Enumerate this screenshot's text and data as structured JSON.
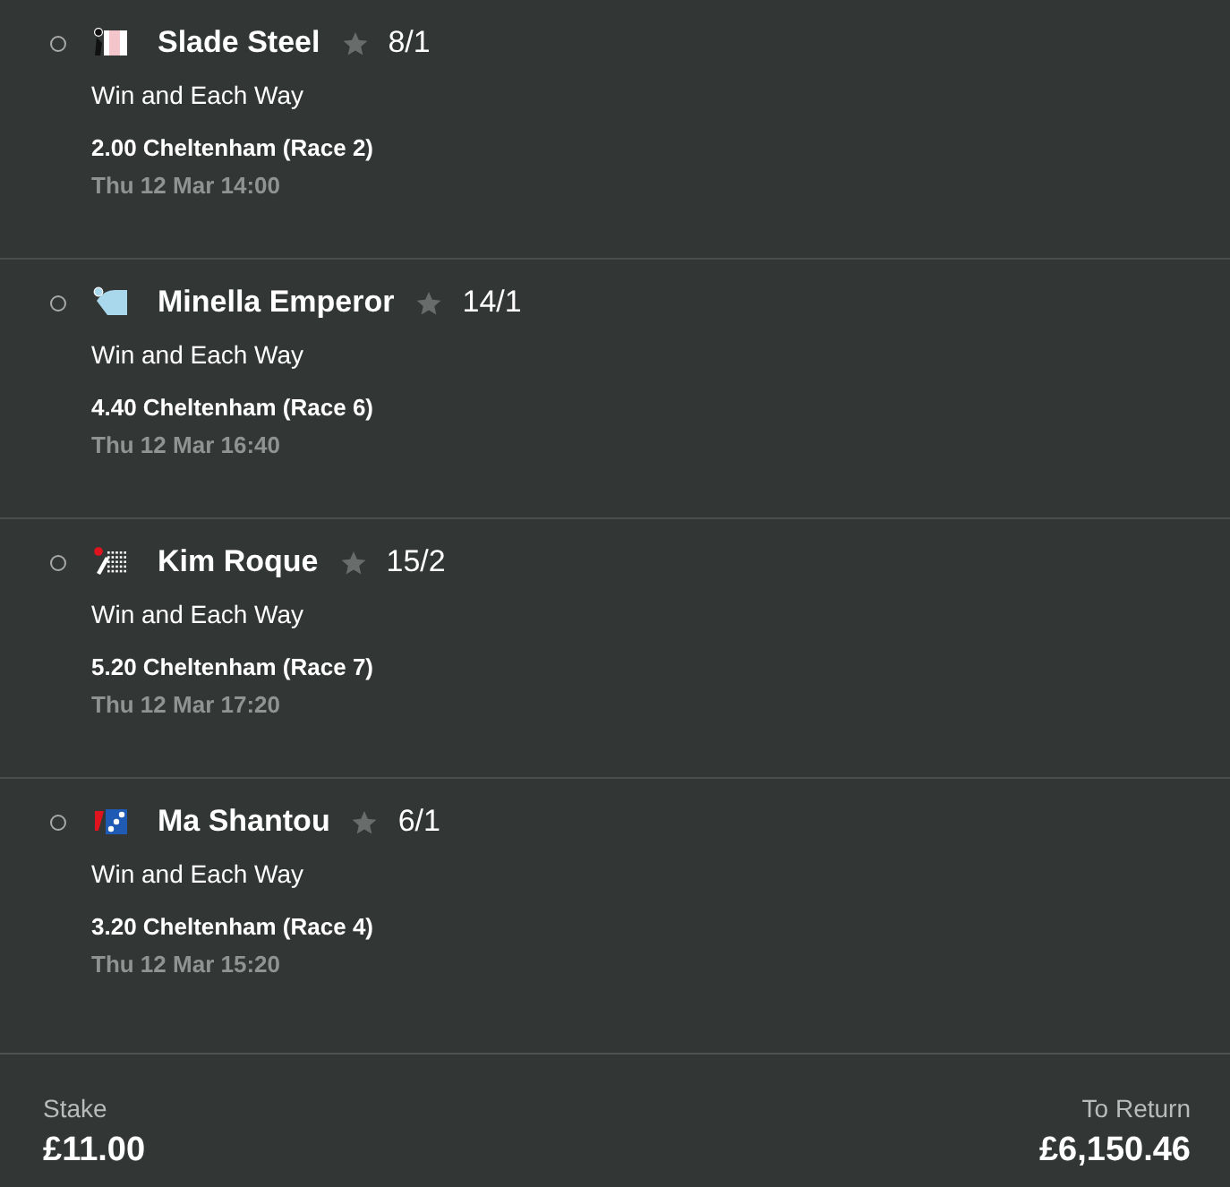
{
  "selections": [
    {
      "selected": false,
      "name": "Slade Steel",
      "odds": "8/1",
      "market": "Win and Each Way",
      "race": "2.00 Cheltenham (Race 2)",
      "time": "Thu 12 Mar 14:00"
    },
    {
      "selected": false,
      "name": "Minella Emperor",
      "odds": "14/1",
      "market": "Win and Each Way",
      "race": "4.40 Cheltenham (Race 6)",
      "time": "Thu 12 Mar 16:40"
    },
    {
      "selected": false,
      "name": "Kim Roque",
      "odds": "15/2",
      "market": "Win and Each Way",
      "race": "5.20 Cheltenham (Race 7)",
      "time": "Thu 12 Mar 17:20"
    },
    {
      "selected": false,
      "name": "Ma Shantou",
      "odds": "6/1",
      "market": "Win and Each Way",
      "race": "3.20 Cheltenham (Race 4)",
      "time": "Thu 12 Mar 15:20"
    }
  ],
  "footer": {
    "stake_label": "Stake",
    "stake": "£11.00",
    "return_label": "To Return",
    "return": "£6,150.46"
  }
}
